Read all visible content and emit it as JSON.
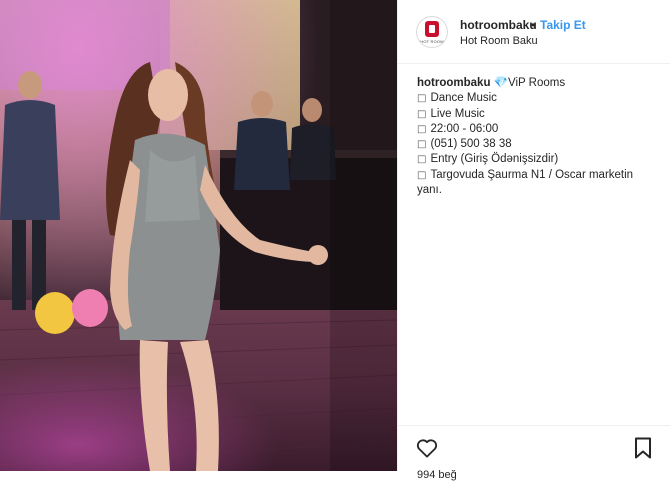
{
  "post": {
    "username": "hotroombaku",
    "separator": "•",
    "follow_label": "Takip Et",
    "location": "Hot Room Baku",
    "avatar_text": "HOT ROOM"
  },
  "caption": {
    "username": "hotroombaku",
    "title": "💎ViP Rooms",
    "bullet": "□",
    "lines": [
      "Dance Music",
      "Live Music",
      "22:00 - 06:00",
      "(051) 500 38 38",
      "Entry (Giriş Ödənişsizdir)",
      "Targovuda Şaurma N1 / Oscar marketin yanı."
    ]
  },
  "actions": {
    "like_icon": "heart-icon",
    "save_icon": "bookmark-icon",
    "likes_partial": "994 beğ"
  },
  "colors": {
    "link": "#3897f0",
    "text": "#262626",
    "border": "#efefef",
    "brand": "#c8102e"
  }
}
